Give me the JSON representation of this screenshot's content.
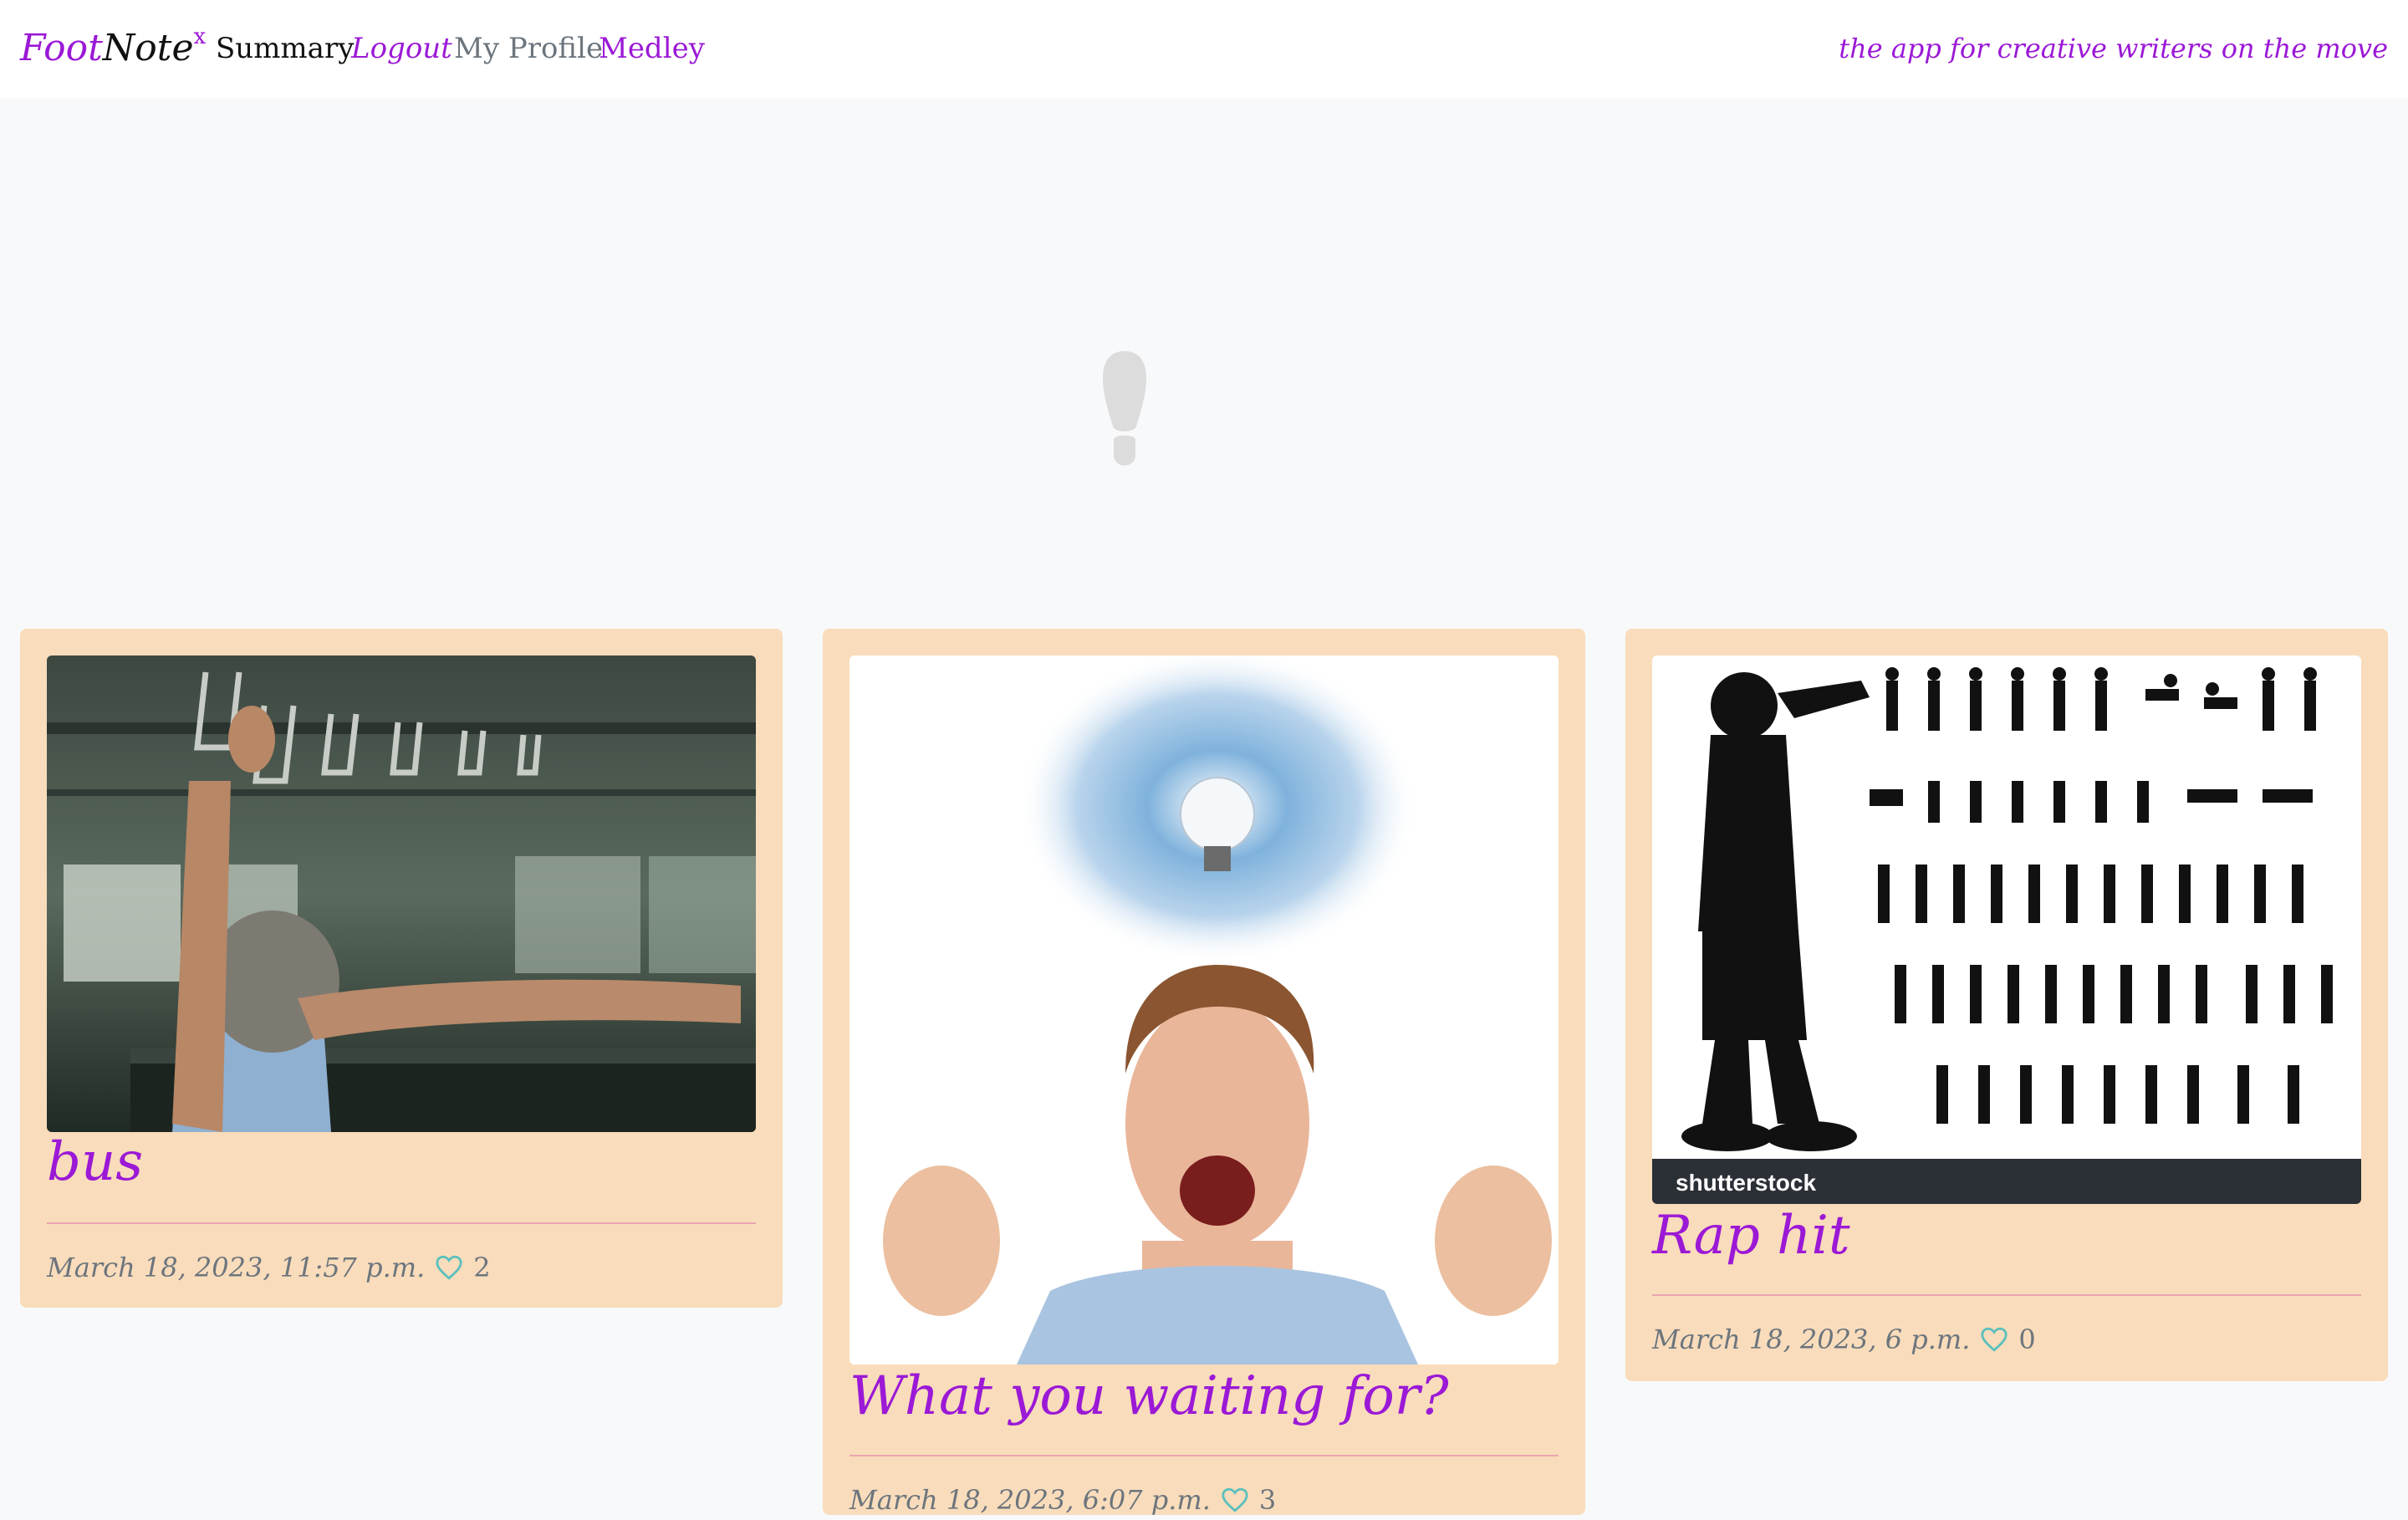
{
  "navbar": {
    "brand_foot": "Foot",
    "brand_note": "Note",
    "brand_sup": "x",
    "links": {
      "summary": "Summary",
      "logout": "Logout",
      "profile": "My Profile",
      "medley": "Medley"
    },
    "tagline": "the app for creative writers on the move"
  },
  "hero": {
    "icon": "footprint-icon"
  },
  "colors": {
    "accent": "#9b19d6",
    "card_background": "#f9dcbb",
    "page_background": "#f8f9fa",
    "heart": "#5bc0be",
    "meta_text": "#6c757d"
  },
  "posts": [
    {
      "title": "bus",
      "date": "March 18, 2023, 11:57 p.m.",
      "likes": "2",
      "image": "bus-interior-photo"
    },
    {
      "title": "What you waiting for?",
      "date": "March 18, 2023, 6:07 p.m.",
      "likes": "3",
      "image": "woman-lightbulb-photo"
    },
    {
      "title": "Rap hit",
      "date": "March 18, 2023, 6 p.m.",
      "likes": "0",
      "image": "rapper-silhouettes-image",
      "image_watermark": "shutterstock"
    }
  ]
}
